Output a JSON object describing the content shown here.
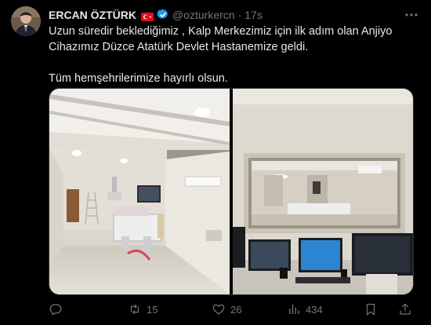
{
  "post": {
    "author_name": "ERCAN ÖZTÜRK",
    "handle": "@ozturkercn",
    "separator": "·",
    "time": "17s",
    "text_line1": "Uzun süredir beklediğimiz , Kalp Merkezimiz için ilk adım olan Anjiyo Cihazımız Düzce Atatürk Devlet Hastanemize geldi.",
    "text_line2": "Tüm hemşehrilerimize hayırlı olsun."
  },
  "actions": {
    "reply_count": "",
    "repost_count": "15",
    "like_count": "26",
    "views_count": "434"
  },
  "icons": {
    "more": "more-horizontal-icon",
    "reply": "reply-icon",
    "repost": "repost-icon",
    "like": "heart-icon",
    "views": "views-icon",
    "bookmark": "bookmark-icon",
    "share": "share-icon",
    "verified": "verified-badge-icon",
    "flag": "turkey-flag-icon"
  },
  "colors": {
    "background": "#000000",
    "text": "#e7e9ea",
    "muted": "#71767b",
    "verified": "#1d9bf0",
    "flag_red": "#e30a17"
  }
}
